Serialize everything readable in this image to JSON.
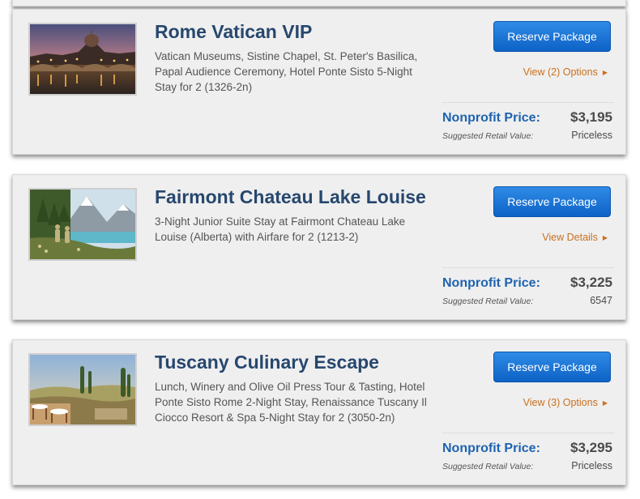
{
  "packages": [
    {
      "title": "Rome Vatican VIP",
      "description": "Vatican Museums, Sistine Chapel, St. Peter's Basilica, Papal Audience Ceremony, Hotel Ponte Sisto 5-Night Stay for 2 (1326-2n)",
      "reserve_label": "Reserve Package",
      "options_label": "View (2) Options",
      "price_label": "Nonprofit Price:",
      "price": "$3,195",
      "retail_label": "Suggested Retail Value:",
      "retail_value": "Priceless"
    },
    {
      "title": "Fairmont Chateau Lake Louise",
      "description": "3-Night Junior Suite Stay at Fairmont Chateau Lake Louise (Alberta) with Airfare for 2 (1213-2)",
      "reserve_label": "Reserve Package",
      "options_label": "View Details",
      "price_label": "Nonprofit Price:",
      "price": "$3,225",
      "retail_label": "Suggested Retail Value:",
      "retail_value": "6547"
    },
    {
      "title": "Tuscany Culinary Escape",
      "description": "Lunch, Winery and Olive Oil Press Tour & Tasting, Hotel Ponte Sisto Rome 2-Night Stay, Renaissance Tuscany Il Ciocco Resort & Spa 5-Night Stay for 2 (3050-2n)",
      "reserve_label": "Reserve Package",
      "options_label": "View (3) Options",
      "price_label": "Nonprofit Price:",
      "price": "$3,295",
      "retail_label": "Suggested Retail Value:",
      "retail_value": "Priceless"
    }
  ],
  "colors": {
    "title": "#27476e",
    "button": "#1473d6",
    "link": "#c9701e",
    "price_label": "#1e63b0"
  },
  "icons": {
    "options_caret": "caret-right-icon"
  }
}
